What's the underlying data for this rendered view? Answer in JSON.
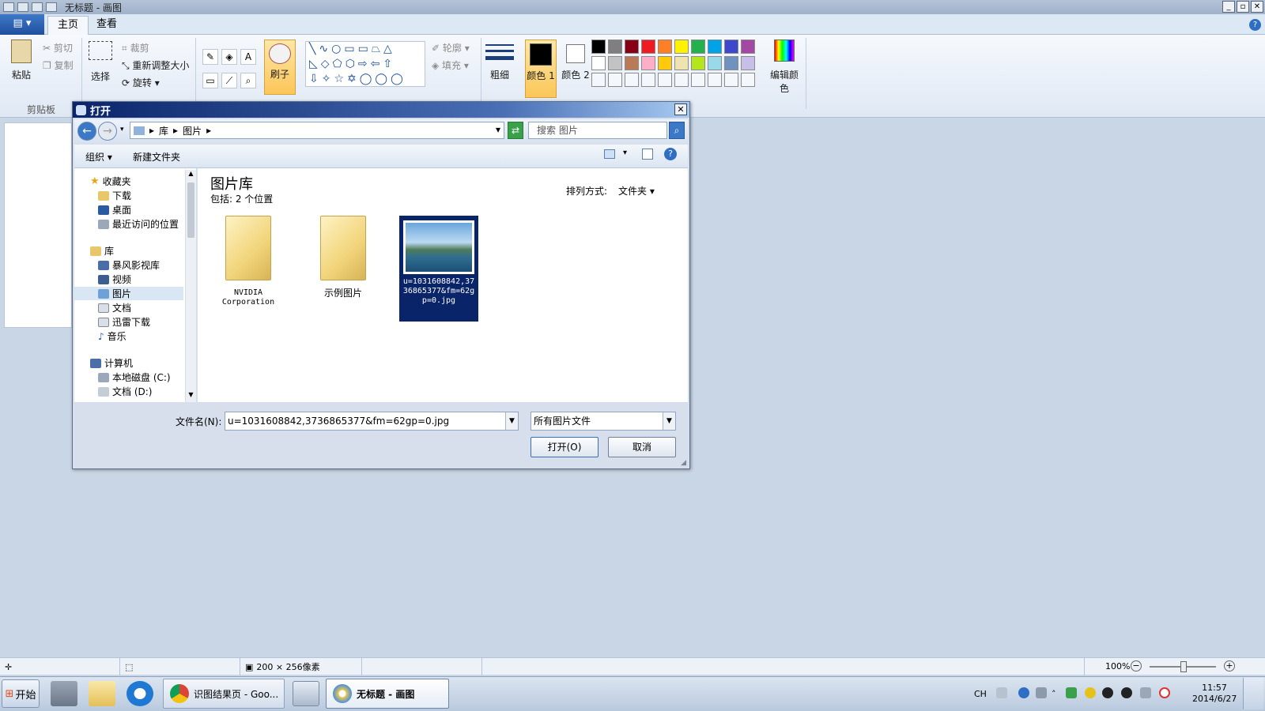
{
  "window": {
    "title": "无标题 - 画图"
  },
  "ribbon": {
    "app_menu": "▤ ▾",
    "tabs": [
      "主页",
      "查看"
    ],
    "clipboard": {
      "paste": "粘贴",
      "cut": "剪切",
      "copy": "复制",
      "label": "剪贴板"
    },
    "image": {
      "select": "选择",
      "crop": "裁剪",
      "resize": "重新调整大小",
      "rotate": "旋转"
    },
    "brush": "刷子",
    "shapes": {
      "outline": "轮廓",
      "fill": "填充"
    },
    "size": "粗细",
    "color1": "颜色 1",
    "color2": "颜色 2",
    "edit_colors": "编辑颜色",
    "palette_row1": [
      "#000000",
      "#7f7f7f",
      "#880015",
      "#ed1c24",
      "#ff7f27",
      "#fff200",
      "#22b14c",
      "#00a2e8",
      "#3f48cc",
      "#a349a4"
    ],
    "palette_row2": [
      "#ffffff",
      "#c3c3c3",
      "#b97a57",
      "#ffaec9",
      "#ffc90e",
      "#efe4b0",
      "#b5e61d",
      "#99d9ea",
      "#7092be",
      "#c8bfe7"
    ]
  },
  "dialog": {
    "title": "打开",
    "breadcrumb": [
      "库",
      "图片"
    ],
    "search_placeholder": "搜索 图片",
    "toolbar": {
      "organize": "组织",
      "new_folder": "新建文件夹"
    },
    "nav": {
      "favorites": "收藏夹",
      "fav_items": [
        "下载",
        "桌面",
        "最近访问的位置"
      ],
      "libraries": "库",
      "lib_items": [
        "暴风影视库",
        "视频",
        "图片",
        "文档",
        "迅雷下载",
        "音乐"
      ],
      "computer": "计算机",
      "drives": [
        "本地磁盘 (C:)",
        "文档 (D:)"
      ]
    },
    "library_title": "图片库",
    "library_sub": "包括: 2 个位置",
    "sort_label": "排列方式:",
    "sort_value": "文件夹",
    "files": [
      {
        "name": "NVIDIA Corporation"
      },
      {
        "name": "示例图片"
      },
      {
        "name": "u=1031608842,3736865377&fm=62gp=0.jpg"
      }
    ],
    "filename_label": "文件名(N):",
    "filename_value": "u=1031608842,3736865377&fm=62gp=0.jpg",
    "filetype_value": "所有图片文件",
    "open_button": "打开(O)",
    "cancel_button": "取消"
  },
  "statusbar": {
    "size": "200 × 256像素",
    "zoom": "100%"
  },
  "taskbar": {
    "start": "开始",
    "items": [
      {
        "label": "识图结果页 - Goo..."
      },
      {
        "label": "无标题 - 画图"
      }
    ],
    "tray": {
      "lang": "CH",
      "time": "11:57",
      "date": "2014/6/27"
    }
  }
}
